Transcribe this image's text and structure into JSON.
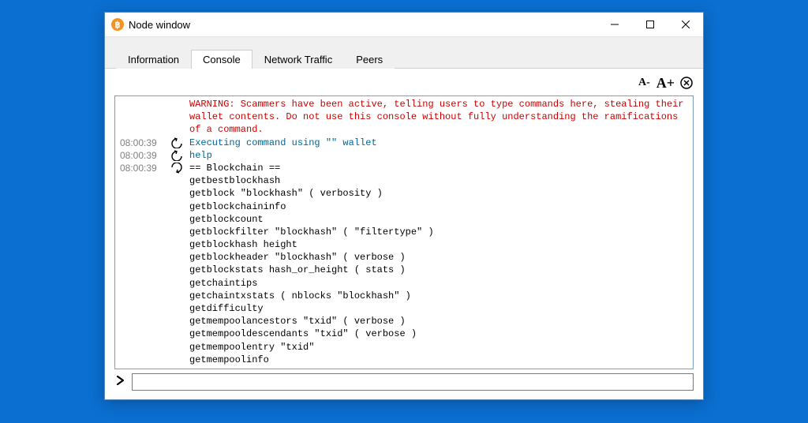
{
  "window": {
    "title": "Node window"
  },
  "tabs": [
    {
      "label": "Information"
    },
    {
      "label": "Console"
    },
    {
      "label": "Network Traffic"
    },
    {
      "label": "Peers"
    }
  ],
  "active_tab": 1,
  "font_controls": {
    "decrease": "A-",
    "increase": "A+"
  },
  "console": {
    "warning": "WARNING: Scammers have been active, telling users to type commands here, stealing their wallet contents. Do not use this console without fully understanding the ramifications of a command.",
    "entries": [
      {
        "ts": "08:00:39",
        "dir": "out",
        "text": "Executing command using \"\" wallet",
        "kind": "cmd"
      },
      {
        "ts": "08:00:39",
        "dir": "out",
        "text": "help",
        "kind": "cmd"
      },
      {
        "ts": "08:00:39",
        "dir": "in",
        "text": "== Blockchain ==\ngetbestblockhash\ngetblock \"blockhash\" ( verbosity )\ngetblockchaininfo\ngetblockcount\ngetblockfilter \"blockhash\" ( \"filtertype\" )\ngetblockhash height\ngetblockheader \"blockhash\" ( verbose )\ngetblockstats hash_or_height ( stats )\ngetchaintips\ngetchaintxstats ( nblocks \"blockhash\" )\ngetdifficulty\ngetmempoolancestors \"txid\" ( verbose )\ngetmempooldescendants \"txid\" ( verbose )\ngetmempoolentry \"txid\"\ngetmempoolinfo",
        "kind": "body"
      }
    ]
  },
  "input": {
    "value": "",
    "placeholder": ""
  }
}
